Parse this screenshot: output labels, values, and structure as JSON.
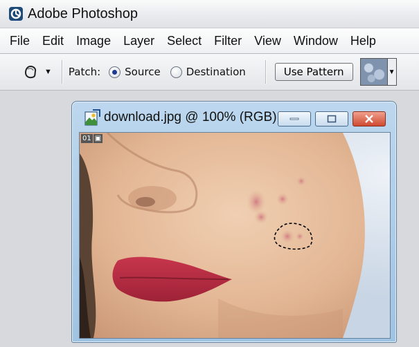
{
  "app": {
    "title": "Adobe Photoshop",
    "icon": "photoshop-logo-icon"
  },
  "menu": [
    "File",
    "Edit",
    "Image",
    "Layer",
    "Select",
    "Filter",
    "View",
    "Window",
    "Help"
  ],
  "options": {
    "tool_icon": "patch-tool-icon",
    "dropdown_icon": "tool-preset-dropdown-icon",
    "patch_label": "Patch:",
    "source_label": "Source",
    "destination_label": "Destination",
    "selected": "Source",
    "use_pattern_label": "Use Pattern",
    "pattern_icon": "pattern-swatch-icon"
  },
  "document": {
    "title": "download.jpg @ 100% (RGB)",
    "icon": "document-icon",
    "badge_number": "01",
    "badge_icon": "image-info-icon"
  },
  "colors": {
    "accent": "#1f3b8f",
    "close": "#cf4a30",
    "window_frame": "#9fc3e3"
  }
}
